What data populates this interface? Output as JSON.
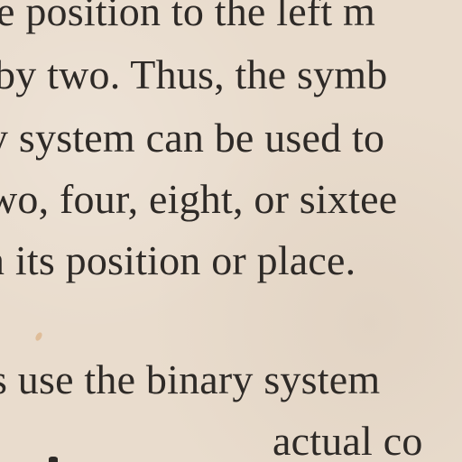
{
  "document": {
    "lines": [
      "e position to the left m",
      "by two. Thus, the symb",
      "y system can be used to",
      "wo, four, eight, or sixtee",
      "n its position or place.",
      "s use the binary system",
      "actual co"
    ]
  },
  "colors": {
    "paper": "#e9dccd",
    "ink": "#2e2a27"
  }
}
